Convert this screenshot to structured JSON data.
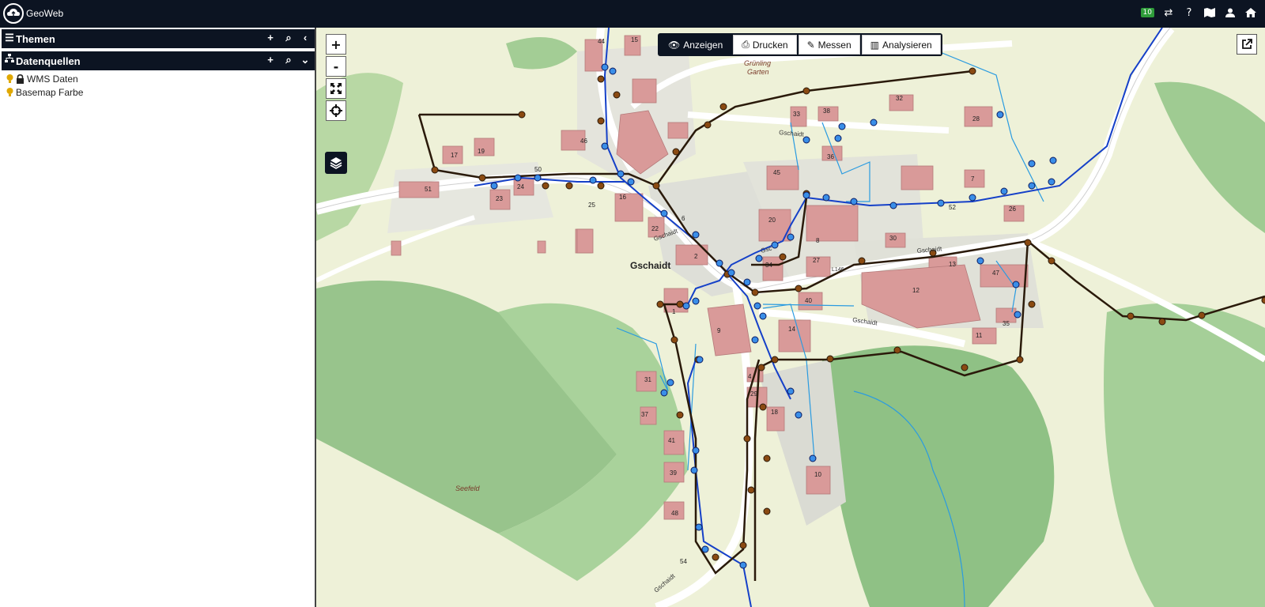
{
  "app": {
    "title": "GeoWeb"
  },
  "topbar": {
    "badge": "10",
    "icons": [
      "transfer-icon",
      "help-icon",
      "map-icon",
      "user-icon",
      "home-icon"
    ]
  },
  "sidebar": {
    "themen": {
      "label": "Themen"
    },
    "datenquellen": {
      "label": "Datenquellen"
    },
    "items": [
      {
        "label": "WMS Daten",
        "locked": true
      },
      {
        "label": "Basemap Farbe",
        "locked": false
      }
    ]
  },
  "toolbar": {
    "buttons": [
      {
        "label": "Anzeigen",
        "active": true
      },
      {
        "label": "Drucken",
        "active": false
      },
      {
        "label": "Messen",
        "active": false
      },
      {
        "label": "Analysieren",
        "active": false
      }
    ]
  },
  "zoom": {
    "plus": "+",
    "minus": "-"
  },
  "map": {
    "places": {
      "village": "Gschaidt",
      "gruening1": "Grünling",
      "gruening2": "Garten",
      "seefeld": "Seefeld",
      "road_top": "Gschaidt",
      "road_mid": "Gschaidt",
      "road_right": "Gschaidt",
      "road_low": "Gschaidt",
      "road_center": "Gsc",
      "road_l": "L146",
      "road_bottom": "Gschaidt"
    },
    "house_numbers": [
      "44",
      "15",
      "46",
      "17",
      "19",
      "51",
      "23",
      "24",
      "50",
      "16",
      "25",
      "22",
      "6",
      "2",
      "1",
      "33",
      "38",
      "32",
      "28",
      "36",
      "45",
      "7",
      "20",
      "8",
      "27",
      "34",
      "30",
      "13",
      "12",
      "47",
      "40",
      "14",
      "35",
      "11",
      "9",
      "4",
      "29",
      "18",
      "31",
      "37",
      "41",
      "39",
      "48",
      "10",
      "26",
      "52",
      "54"
    ]
  }
}
